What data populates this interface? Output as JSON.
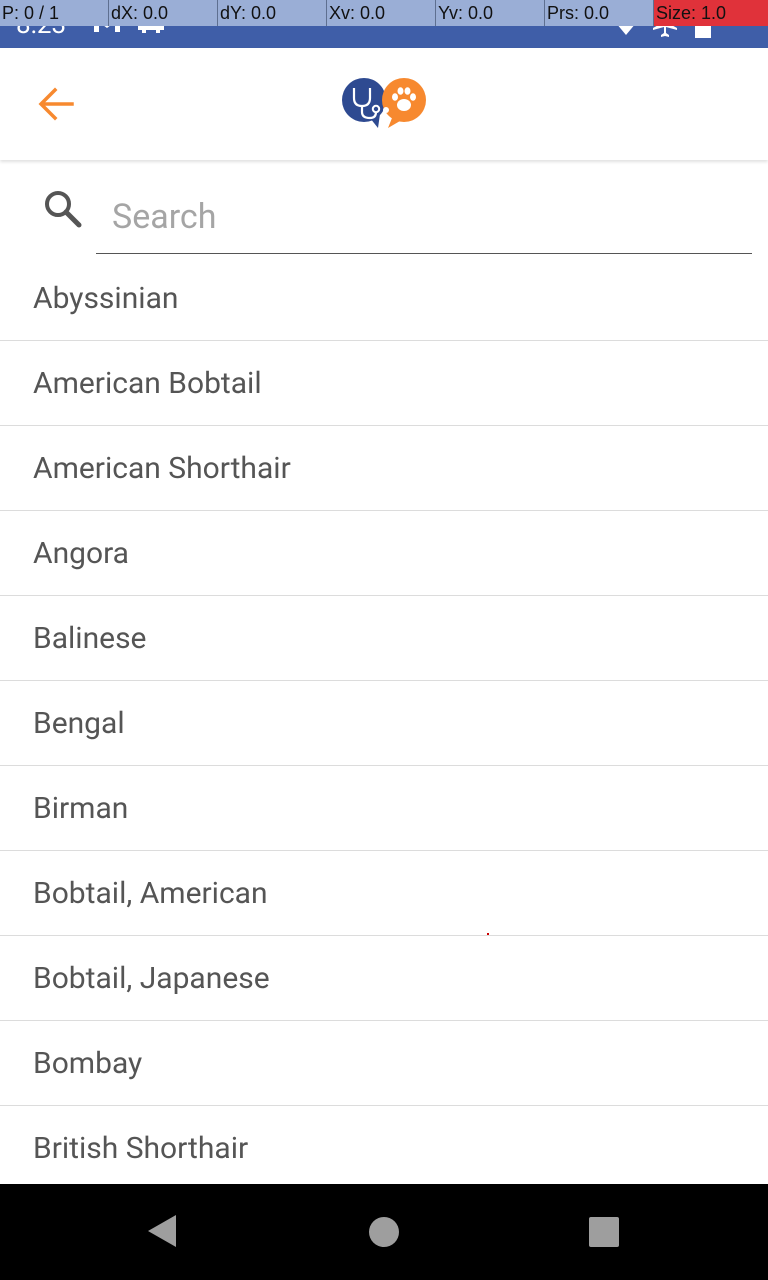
{
  "status_bar": {
    "time": "8:23"
  },
  "debug_overlay": {
    "pointer": "P: 0 / 1",
    "dx": "dX: 0.0",
    "dy": "dY: 0.0",
    "xv": "Xv: 0.0",
    "yv": "Yv: 0.0",
    "prs": "Prs: 0.0",
    "size": "Size: 1.0"
  },
  "app_bar": {
    "back_icon": "arrow-back-icon",
    "logo": "vet-pet-logo"
  },
  "search": {
    "placeholder": "Search",
    "value": ""
  },
  "breeds": [
    "Abyssinian",
    "American Bobtail",
    "American Shorthair",
    "Angora",
    "Balinese",
    "Bengal",
    "Birman",
    "Bobtail, American",
    "Bobtail, Japanese",
    "Bombay",
    "British Shorthair"
  ],
  "colors": {
    "status_bar": "#3f5ea8",
    "accent_orange": "#f7892f",
    "logo_blue": "#2e4a91",
    "text": "#555555"
  }
}
